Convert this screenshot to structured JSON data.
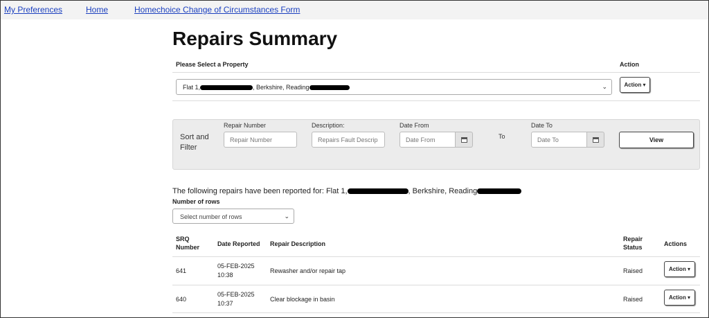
{
  "nav": {
    "links": [
      "My Preferences",
      "Home",
      "Homechoice Change of Circumstances Form"
    ],
    "link_color": "#1a3fbf"
  },
  "page": {
    "title": "Repairs Summary"
  },
  "property": {
    "label": "Please Select a Property",
    "action_label": "Action",
    "selected": {
      "prefix": "Flat 1,",
      "middle": ", Berkshire, Reading"
    },
    "action_button": "Action ▾"
  },
  "filter": {
    "title": "Sort and Filter",
    "repair_number": {
      "label": "Repair Number",
      "placeholder": "Repair Number"
    },
    "description": {
      "label": "Description:",
      "placeholder": "Repairs Fault Descrip"
    },
    "date_from": {
      "label": "Date From",
      "placeholder": "Date From"
    },
    "to_label": "To",
    "date_to": {
      "label": "Date To",
      "placeholder": "Date To"
    },
    "view_button": "View",
    "background": "#ececec"
  },
  "report": {
    "prefix": "The following repairs have been reported for: Flat 1,",
    "middle": ", Berkshire, Reading"
  },
  "rows_selector": {
    "label": "Number of rows",
    "selected": "Select number of rows"
  },
  "table": {
    "headers": {
      "srq": "SRQ Number",
      "date": "Date Reported",
      "description": "Repair Description",
      "status": "Repair Status",
      "actions": "Actions"
    },
    "rows": [
      {
        "srq": "641",
        "date": "05-FEB-2025",
        "time": "10:38",
        "description": "Rewasher and/or repair tap",
        "status": "Raised",
        "action": "Action ▾"
      },
      {
        "srq": "640",
        "date": "05-FEB-2025",
        "time": "10:37",
        "description": "Clear blockage in basin",
        "status": "Raised",
        "action": "Action ▾"
      }
    ]
  }
}
